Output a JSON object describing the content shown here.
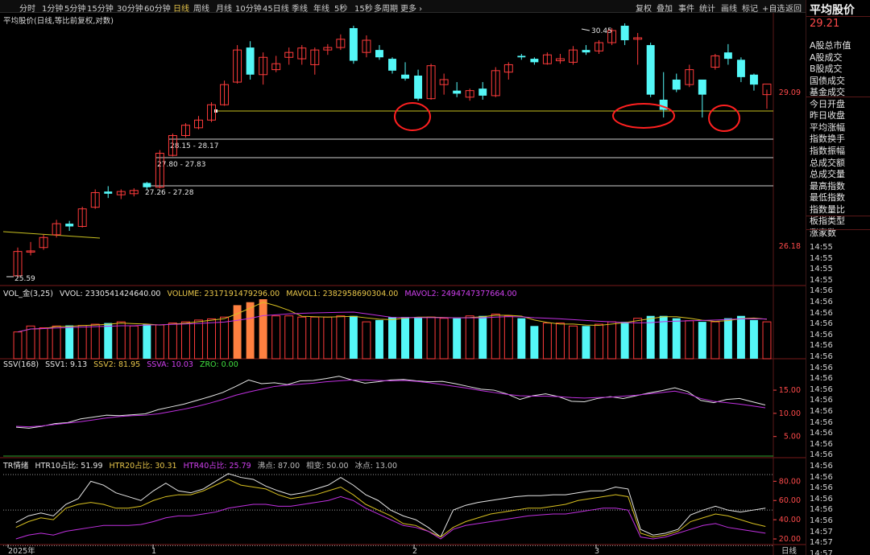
{
  "toolbar": {
    "left": [
      "分时",
      "1分钟",
      "5分钟",
      "15分钟",
      "30分钟",
      "60分钟",
      "日线",
      "周线",
      "月线",
      "10分钟",
      "45日线",
      "季线",
      "年线",
      "5秒",
      "15秒",
      "多周期",
      "更多 ›"
    ],
    "active": "日线",
    "right": [
      "复权",
      "叠加",
      "事件",
      "统计",
      "画线",
      "标记",
      "+自选",
      "返回"
    ]
  },
  "main_title": "平均股价(日线,等比前复权,对数)",
  "main_axis": [
    "29.09",
    "26.18"
  ],
  "price_labels": {
    "high": "30.45",
    "low": "25.59",
    "level1": "28.15 - 28.17",
    "level2": "27.80 - 27.83",
    "level3": "27.26 - 27.28"
  },
  "vol": {
    "name": "VOL_金(3,25)",
    "vvol": "VVOL: 2330541424640.00",
    "volume": "VOLUME: 2317191479296.00",
    "mavol1": "MAVOL1: 2382958690304.00",
    "mavol2": "MAVOL2: 2494747377664.00"
  },
  "ssv": {
    "name": "SSV(168)",
    "ssv1": "SSV1: 9.13",
    "ssv2": "SSV2: 81.95",
    "ssva": "SSVA: 10.03",
    "zro": "ZRO: 0.00",
    "axis": [
      "15.00",
      "10.00",
      "5.00"
    ]
  },
  "tr": {
    "name": "TR情绪",
    "htr10": "HTR10占比: 51.99",
    "htr20": "HTR20占比: 30.31",
    "htr40": "HTR40占比: 25.79",
    "boil": "沸点: 87.00",
    "phase": "相变: 50.00",
    "ice": "冰点: 13.00",
    "axis": [
      "80.00",
      "60.00",
      "40.00",
      "20.00"
    ]
  },
  "date_axis": [
    "2025年",
    "1",
    "2",
    "3"
  ],
  "period_label": "日线",
  "right_panel": {
    "title": "平均股价",
    "price": "29.21",
    "items": [
      "A股总市值",
      "A股成交",
      "B股成交",
      "国债成交",
      "基金成交",
      "今日开盘",
      "昨日收盘",
      "平均涨幅",
      "指数换手",
      "指数振幅",
      "总成交额",
      "总成交量",
      "最高指数",
      "最低指数",
      "指数量比",
      "板指类型",
      "涨家数"
    ],
    "times": [
      "14:55",
      "14:55",
      "14:55",
      "14:55",
      "14:56",
      "14:56",
      "14:56",
      "14:56",
      "14:56",
      "14:56",
      "14:56",
      "14:56",
      "14:56",
      "14:56",
      "14:56",
      "14:56",
      "14:56",
      "14:56",
      "14:56",
      "14:56",
      "14:56",
      "14:56",
      "14:56",
      "14:56",
      "14:56",
      "14:56",
      "14:57",
      "14:57",
      "14:57"
    ]
  },
  "colors": {
    "up": "#ff3b3b",
    "down": "#54f7f7",
    "vol_up_hot": "#ff8040",
    "support_line": "#c8c020",
    "white_line": "#e6e6e6",
    "yellow_line": "#d8c020",
    "purple_line": "#c030e0",
    "highlight_circle": "#ff2020"
  },
  "chart_data": {
    "type": "candlestick",
    "scale": "log",
    "candles": [
      {
        "o": 25.62,
        "h": 26.12,
        "l": 25.59,
        "c": 26.05
      },
      {
        "o": 26.05,
        "h": 26.22,
        "l": 25.98,
        "c": 26.06
      },
      {
        "o": 26.12,
        "h": 26.35,
        "l": 26.08,
        "c": 26.3
      },
      {
        "o": 26.35,
        "h": 26.62,
        "l": 26.3,
        "c": 26.55
      },
      {
        "o": 26.55,
        "h": 26.6,
        "l": 26.42,
        "c": 26.5
      },
      {
        "o": 26.5,
        "h": 26.86,
        "l": 26.48,
        "c": 26.82
      },
      {
        "o": 26.85,
        "h": 27.18,
        "l": 26.82,
        "c": 27.12
      },
      {
        "o": 27.14,
        "h": 27.24,
        "l": 27.02,
        "c": 27.1
      },
      {
        "o": 27.08,
        "h": 27.18,
        "l": 27.0,
        "c": 27.14
      },
      {
        "o": 27.1,
        "h": 27.2,
        "l": 27.05,
        "c": 27.16
      },
      {
        "o": 27.3,
        "h": 27.32,
        "l": 27.18,
        "c": 27.22
      },
      {
        "o": 27.22,
        "h": 27.92,
        "l": 27.2,
        "c": 27.86
      },
      {
        "o": 27.82,
        "h": 28.24,
        "l": 27.8,
        "c": 28.2
      },
      {
        "o": 28.2,
        "h": 28.44,
        "l": 28.16,
        "c": 28.4
      },
      {
        "o": 28.35,
        "h": 28.58,
        "l": 28.32,
        "c": 28.5
      },
      {
        "o": 28.5,
        "h": 28.85,
        "l": 28.46,
        "c": 28.8
      },
      {
        "o": 28.8,
        "h": 29.28,
        "l": 28.78,
        "c": 29.2
      },
      {
        "o": 29.25,
        "h": 30.0,
        "l": 29.22,
        "c": 29.9
      },
      {
        "o": 29.95,
        "h": 30.08,
        "l": 29.3,
        "c": 29.4
      },
      {
        "o": 29.4,
        "h": 29.85,
        "l": 29.2,
        "c": 29.75
      },
      {
        "o": 29.5,
        "h": 29.78,
        "l": 29.45,
        "c": 29.62
      },
      {
        "o": 29.75,
        "h": 29.95,
        "l": 29.6,
        "c": 29.85
      },
      {
        "o": 29.72,
        "h": 30.0,
        "l": 29.6,
        "c": 29.94
      },
      {
        "o": 29.6,
        "h": 29.95,
        "l": 29.4,
        "c": 29.9
      },
      {
        "o": 29.9,
        "h": 30.02,
        "l": 29.8,
        "c": 29.95
      },
      {
        "o": 29.95,
        "h": 30.22,
        "l": 29.9,
        "c": 30.12
      },
      {
        "o": 30.35,
        "h": 30.4,
        "l": 29.62,
        "c": 29.68
      },
      {
        "o": 29.85,
        "h": 30.2,
        "l": 29.75,
        "c": 30.1
      },
      {
        "o": 29.9,
        "h": 30.0,
        "l": 29.7,
        "c": 29.75
      },
      {
        "o": 29.72,
        "h": 29.75,
        "l": 29.42,
        "c": 29.48
      },
      {
        "o": 29.4,
        "h": 29.65,
        "l": 29.28,
        "c": 29.32
      },
      {
        "o": 29.38,
        "h": 29.5,
        "l": 28.88,
        "c": 28.92
      },
      {
        "o": 28.92,
        "h": 29.62,
        "l": 28.9,
        "c": 29.58
      },
      {
        "o": 29.2,
        "h": 29.42,
        "l": 29.0,
        "c": 29.3
      },
      {
        "o": 29.08,
        "h": 29.25,
        "l": 28.95,
        "c": 29.02
      },
      {
        "o": 28.95,
        "h": 29.12,
        "l": 28.88,
        "c": 29.08
      },
      {
        "o": 29.12,
        "h": 29.25,
        "l": 28.9,
        "c": 28.98
      },
      {
        "o": 28.98,
        "h": 29.55,
        "l": 28.95,
        "c": 29.48
      },
      {
        "o": 29.45,
        "h": 29.65,
        "l": 29.3,
        "c": 29.6
      },
      {
        "o": 29.78,
        "h": 29.82,
        "l": 29.7,
        "c": 29.75
      },
      {
        "o": 29.72,
        "h": 29.75,
        "l": 29.6,
        "c": 29.65
      },
      {
        "o": 29.62,
        "h": 29.85,
        "l": 29.6,
        "c": 29.8
      },
      {
        "o": 29.68,
        "h": 29.82,
        "l": 29.62,
        "c": 29.72
      },
      {
        "o": 29.65,
        "h": 29.98,
        "l": 29.6,
        "c": 29.9
      },
      {
        "o": 29.9,
        "h": 30.0,
        "l": 29.8,
        "c": 29.85
      },
      {
        "o": 29.88,
        "h": 30.1,
        "l": 29.82,
        "c": 30.05
      },
      {
        "o": 30.05,
        "h": 30.35,
        "l": 30.0,
        "c": 30.3
      },
      {
        "o": 30.4,
        "h": 30.45,
        "l": 30.0,
        "c": 30.1
      },
      {
        "o": 30.12,
        "h": 30.25,
        "l": 29.6,
        "c": 30.15
      },
      {
        "o": 30.0,
        "h": 30.05,
        "l": 28.95,
        "c": 29.0
      },
      {
        "o": 28.9,
        "h": 29.45,
        "l": 28.55,
        "c": 28.7
      },
      {
        "o": 29.3,
        "h": 29.42,
        "l": 29.05,
        "c": 29.1
      },
      {
        "o": 29.2,
        "h": 29.6,
        "l": 29.15,
        "c": 29.5
      },
      {
        "o": 29.3,
        "h": 29.1,
        "l": 28.55,
        "c": 29.0
      },
      {
        "o": 29.55,
        "h": 29.82,
        "l": 29.5,
        "c": 29.78
      },
      {
        "o": 29.85,
        "h": 30.02,
        "l": 29.6,
        "c": 29.72
      },
      {
        "o": 29.7,
        "h": 29.75,
        "l": 29.25,
        "c": 29.35
      },
      {
        "o": 29.4,
        "h": 29.42,
        "l": 29.08,
        "c": 29.2
      },
      {
        "o": 29.0,
        "h": 29.1,
        "l": 28.72,
        "c": 29.21
      }
    ],
    "support_levels": [
      28.96,
      28.56,
      28.0,
      27.42
    ],
    "volume": [
      0.45,
      0.55,
      0.52,
      0.55,
      0.56,
      0.56,
      0.58,
      0.6,
      0.62,
      0.55,
      0.58,
      0.57,
      0.6,
      0.62,
      0.65,
      0.67,
      0.7,
      0.9,
      0.95,
      1.0,
      0.72,
      0.72,
      0.7,
      0.7,
      0.7,
      0.72,
      0.72,
      0.62,
      0.65,
      0.7,
      0.7,
      0.7,
      0.7,
      0.68,
      0.68,
      0.72,
      0.72,
      0.75,
      0.72,
      0.68,
      0.55,
      0.6,
      0.6,
      0.55,
      0.55,
      0.58,
      0.62,
      0.62,
      0.68,
      0.72,
      0.72,
      0.68,
      0.64,
      0.62,
      0.62,
      0.68,
      0.72,
      0.65,
      0.62
    ],
    "ssv_white": [
      7.0,
      6.8,
      7.2,
      7.8,
      8.0,
      8.8,
      9.2,
      9.6,
      9.5,
      9.7,
      9.9,
      10.8,
      11.4,
      12.0,
      12.8,
      13.6,
      14.5,
      15.8,
      17.2,
      16.4,
      16.6,
      16.2,
      17.0,
      17.1,
      17.5,
      18.0,
      17.2,
      16.5,
      16.8,
      17.2,
      17.3,
      17.0,
      16.8,
      16.9,
      16.4,
      15.8,
      15.2,
      15.0,
      14.2,
      13.0,
      13.8,
      14.2,
      13.6,
      12.6,
      12.5,
      13.2,
      13.6,
      13.2,
      13.8,
      14.4,
      14.9,
      15.5,
      14.7,
      12.8,
      12.3,
      13.0,
      13.2,
      12.5,
      11.8
    ],
    "ssv_purple": [
      7.2,
      7.1,
      7.3,
      7.6,
      7.9,
      8.2,
      8.6,
      9.0,
      9.3,
      9.5,
      9.6,
      9.9,
      10.4,
      10.9,
      11.5,
      12.2,
      13.0,
      13.9,
      14.6,
      15.2,
      15.8,
      16.1,
      16.3,
      16.5,
      16.8,
      17.0,
      17.2,
      17.2,
      17.1,
      17.0,
      17.1,
      16.9,
      16.6,
      16.2,
      15.8,
      15.4,
      14.9,
      14.5,
      14.1,
      13.8,
      13.7,
      13.7,
      13.6,
      13.4,
      13.3,
      13.4,
      13.5,
      13.7,
      13.9,
      14.2,
      14.5,
      14.8,
      14.2,
      13.2,
      12.6,
      12.3,
      12.0,
      11.6,
      11.2
    ],
    "tr_white": [
      37,
      44,
      47,
      44,
      56,
      62,
      80,
      76,
      68,
      64,
      60,
      70,
      78,
      70,
      68,
      72,
      80,
      88,
      84,
      82,
      75,
      70,
      66,
      68,
      72,
      76,
      84,
      76,
      66,
      60,
      50,
      44,
      40,
      32,
      22,
      50,
      55,
      58,
      60,
      62,
      64,
      65,
      65,
      66,
      66,
      68,
      70,
      70,
      74,
      72,
      30,
      24,
      26,
      30,
      45,
      50,
      54,
      50,
      48,
      50,
      52
    ],
    "tr_yellow": [
      32,
      38,
      42,
      40,
      52,
      56,
      58,
      56,
      52,
      52,
      54,
      60,
      64,
      66,
      66,
      70,
      76,
      82,
      76,
      74,
      72,
      66,
      62,
      64,
      66,
      70,
      74,
      66,
      56,
      50,
      44,
      36,
      34,
      28,
      22,
      32,
      38,
      42,
      46,
      48,
      50,
      52,
      52,
      54,
      56,
      60,
      62,
      64,
      66,
      64,
      26,
      22,
      24,
      28,
      38,
      42,
      46,
      44,
      40,
      36,
      33
    ],
    "tr_purple": [
      20,
      24,
      26,
      24,
      28,
      30,
      32,
      34,
      34,
      34,
      35,
      38,
      42,
      44,
      44,
      46,
      48,
      52,
      54,
      56,
      56,
      54,
      54,
      56,
      58,
      60,
      64,
      60,
      52,
      46,
      40,
      34,
      32,
      28,
      20,
      30,
      34,
      36,
      38,
      40,
      42,
      44,
      45,
      46,
      46,
      48,
      50,
      52,
      52,
      50,
      22,
      20,
      22,
      26,
      30,
      34,
      36,
      32,
      30,
      28,
      26
    ]
  }
}
